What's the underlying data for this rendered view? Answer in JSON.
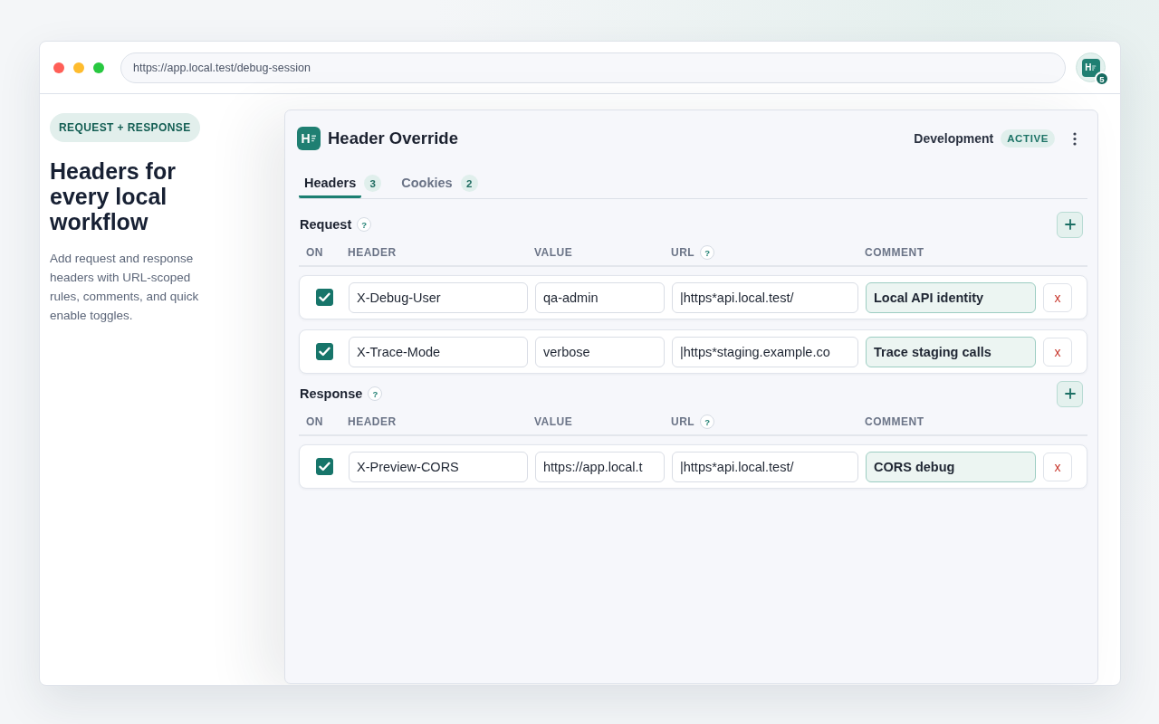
{
  "browser": {
    "url": "https://app.local.test/debug-session",
    "extension": {
      "logo_text": "H",
      "badge": "5"
    }
  },
  "intro": {
    "tag": "REQUEST + RESPONSE",
    "title": "Headers for every local workflow",
    "description": "Add request and response headers with URL-scoped rules, comments, and quick enable toggles."
  },
  "popup": {
    "logo_text": "H",
    "title": "Header Override",
    "profile": "Development",
    "status": "ACTIVE",
    "tabs": [
      {
        "label": "Headers",
        "count": "3",
        "selected": true
      },
      {
        "label": "Cookies",
        "count": "2",
        "selected": false
      }
    ],
    "sections": [
      {
        "title": "Request",
        "help": "?",
        "columns": [
          {
            "label": "ON"
          },
          {
            "label": "HEADER"
          },
          {
            "label": "VALUE"
          },
          {
            "label": "URL",
            "help": "?"
          },
          {
            "label": "COMMENT"
          }
        ],
        "rules": [
          {
            "enabled": true,
            "header": "X-Debug-User",
            "value": "qa-admin",
            "url": "|https*api.local.test/",
            "comment": "Local API identity",
            "delete_label": "x"
          },
          {
            "enabled": true,
            "header": "X-Trace-Mode",
            "value": "verbose",
            "url": "|https*staging.example.co",
            "comment": "Trace staging calls",
            "delete_label": "x"
          }
        ]
      },
      {
        "title": "Response",
        "help": "?",
        "columns": [
          {
            "label": "ON"
          },
          {
            "label": "HEADER"
          },
          {
            "label": "VALUE"
          },
          {
            "label": "URL",
            "help": "?"
          },
          {
            "label": "COMMENT"
          }
        ],
        "rules": [
          {
            "enabled": true,
            "header": "X-Preview-CORS",
            "value": "https://app.local.t",
            "url": "|https*api.local.test/",
            "comment": "CORS debug",
            "delete_label": "x"
          }
        ]
      }
    ]
  }
}
